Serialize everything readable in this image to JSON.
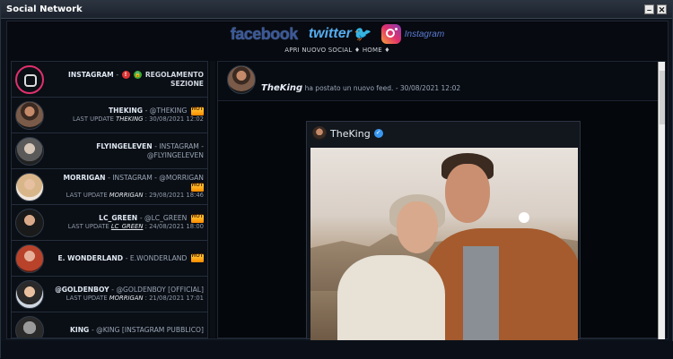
{
  "window": {
    "title": "Social Network"
  },
  "social_bar": {
    "facebook": "facebook",
    "twitter": "twitter",
    "instagram": "Instagram"
  },
  "nav": {
    "text": "APRI NUOVO SOCIAL ♦ HOME ♦"
  },
  "sidebar": {
    "items": [
      {
        "name": "INSTAGRAM",
        "sub": " - ",
        "extra": "REGOLAMENTO SEZIONE",
        "last_update": ""
      },
      {
        "name": "THEKING",
        "sub": " - @THEKING",
        "extra": "",
        "last_update_prefix": "LAST UPDATE ",
        "last_update_user": "THEKING",
        "last_update_time": " : 30/08/2021 12:02"
      },
      {
        "name": "FLYINGELEVEN",
        "sub": " - INSTAGRAM - @FLYINGELEVEN",
        "extra": ""
      },
      {
        "name": "MORRIGAN",
        "sub": " - INSTAGRAM - @MORRIGAN",
        "extra": "",
        "last_update_prefix": "LAST UPDATE ",
        "last_update_user": "MORRIGAN",
        "last_update_time": " : 29/08/2021 18:46"
      },
      {
        "name": "LC_GREEN",
        "sub": " - @LC_GREEN",
        "extra": "",
        "last_update_prefix": "LAST UPDATE ",
        "last_update_user": "LC_GREEN",
        "last_update_time": " : 24/08/2021 18:00"
      },
      {
        "name": "E. WONDERLAND",
        "sub": " - E.WONDERLAND",
        "extra": ""
      },
      {
        "name": "@GOLDENBOY",
        "sub": " - @GOLDENBOY [OFFICIAL]",
        "extra": "",
        "last_update_prefix": "LAST UPDATE ",
        "last_update_user": "MORRIGAN",
        "last_update_time": " : 21/08/2021 17:01"
      },
      {
        "name": "KING",
        "sub": " - @KING [INSTAGRAM PUBBLICO]",
        "extra": ""
      }
    ]
  },
  "post": {
    "author": "TheKing",
    "action": "ha postato un nuovo feed.",
    "timestamp": " - 30/08/2021 12:02",
    "card_name": "TheKing"
  },
  "badges": {
    "hot": "HOT"
  },
  "colors": {
    "facebook": "#3b5998",
    "twitter": "#55acee",
    "verified": "#3897f0"
  }
}
